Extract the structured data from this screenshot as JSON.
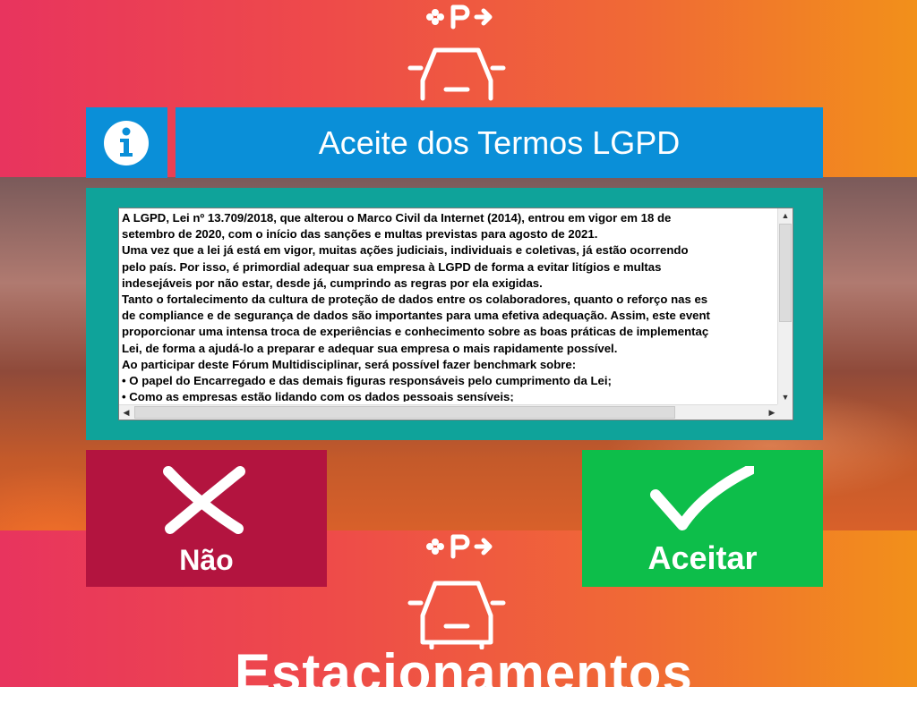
{
  "background": {
    "brand_text": "Estacionamentos"
  },
  "dialog": {
    "title": "Aceite dos Termos LGPD",
    "info_icon": "info-icon",
    "terms_lines": [
      " A LGPD, Lei nº 13.709/2018, que alterou o Marco Civil da Internet (2014), entrou em vigor em 18 de",
      "setembro de 2020, com o início das sanções e multas previstas para agosto de 2021.",
      "Uma vez que a lei já está em vigor, muitas ações judiciais, individuais e coletivas, já estão ocorrendo",
      "pelo país. Por isso, é primordial adequar sua empresa à LGPD de forma a evitar litígios e multas",
      "indesejáveis por não estar, desde já, cumprindo as regras por ela exigidas.",
      "Tanto o fortalecimento da cultura de proteção de dados entre os colaboradores, quanto o reforço nas es",
      "de compliance e de segurança de dados são importantes para uma efetiva adequação. Assim, este event",
      "proporcionar uma intensa troca de experiências e conhecimento sobre as boas práticas de implementaç",
      "Lei, de forma a ajudá-lo a preparar e adequar sua empresa o mais rapidamente possível.",
      " Ao participar deste Fórum Multidisciplinar, será possível fazer benchmark sobre:",
      "• O papel do Encarregado e das demais figuras responsáveis pelo cumprimento da Lei;",
      "• Como as empresas estão lidando com os dados pessoais sensíveis;"
    ]
  },
  "buttons": {
    "reject_label": "Não",
    "accept_label": "Aceitar"
  },
  "colors": {
    "header_blue": "#0a8fd8",
    "panel_teal": "#0fa39a",
    "reject_red": "#b3143f",
    "accept_green": "#0dbe4a"
  }
}
